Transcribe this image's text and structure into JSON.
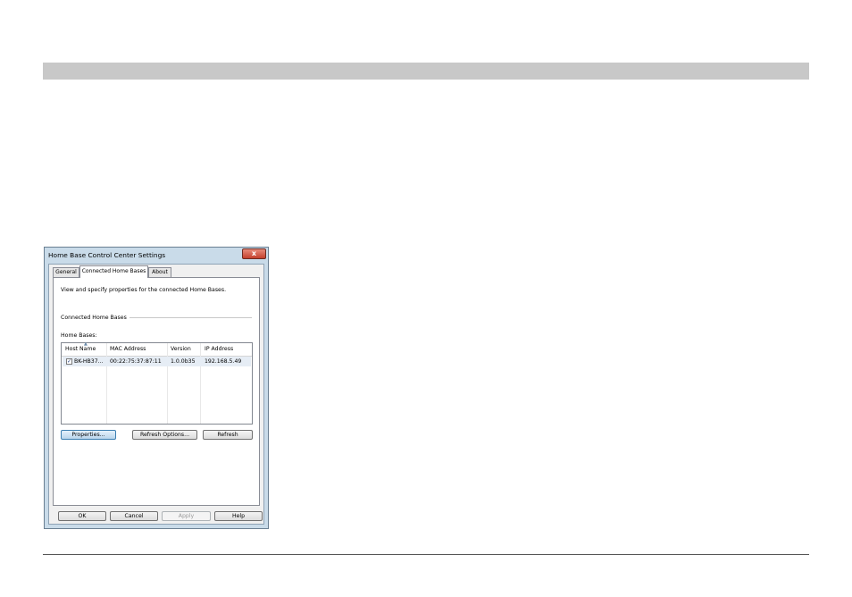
{
  "window": {
    "title": "Home Base Control Center Settings",
    "close_glyph": "x"
  },
  "tabs": [
    {
      "label": "General",
      "active": false
    },
    {
      "label": "Connected Home Bases",
      "active": true
    },
    {
      "label": "About",
      "active": false
    }
  ],
  "panel": {
    "description": "View and specify properties for the connected Home Bases.",
    "group_label": "Connected Home Bases",
    "list_label": "Home Bases:"
  },
  "table": {
    "columns": [
      "Host Name",
      "MAC Address",
      "Version",
      "IP Address"
    ],
    "rows": [
      {
        "checked": true,
        "host": "BK-HB37...",
        "mac": "00:22:75:37:87:11",
        "version": "1.0.0b35",
        "ip": "192.168.5.49"
      }
    ]
  },
  "panel_buttons": {
    "properties": "Properties...",
    "refresh_options": "Refresh Options...",
    "refresh": "Refresh"
  },
  "dialog_buttons": {
    "ok": "OK",
    "cancel": "Cancel",
    "apply": "Apply",
    "help": "Help"
  },
  "colors": {
    "frame": "#c9dbe9",
    "close_button": "#c4402c",
    "selection": "#e6edf5",
    "default_button_border": "#3c7fb1"
  }
}
